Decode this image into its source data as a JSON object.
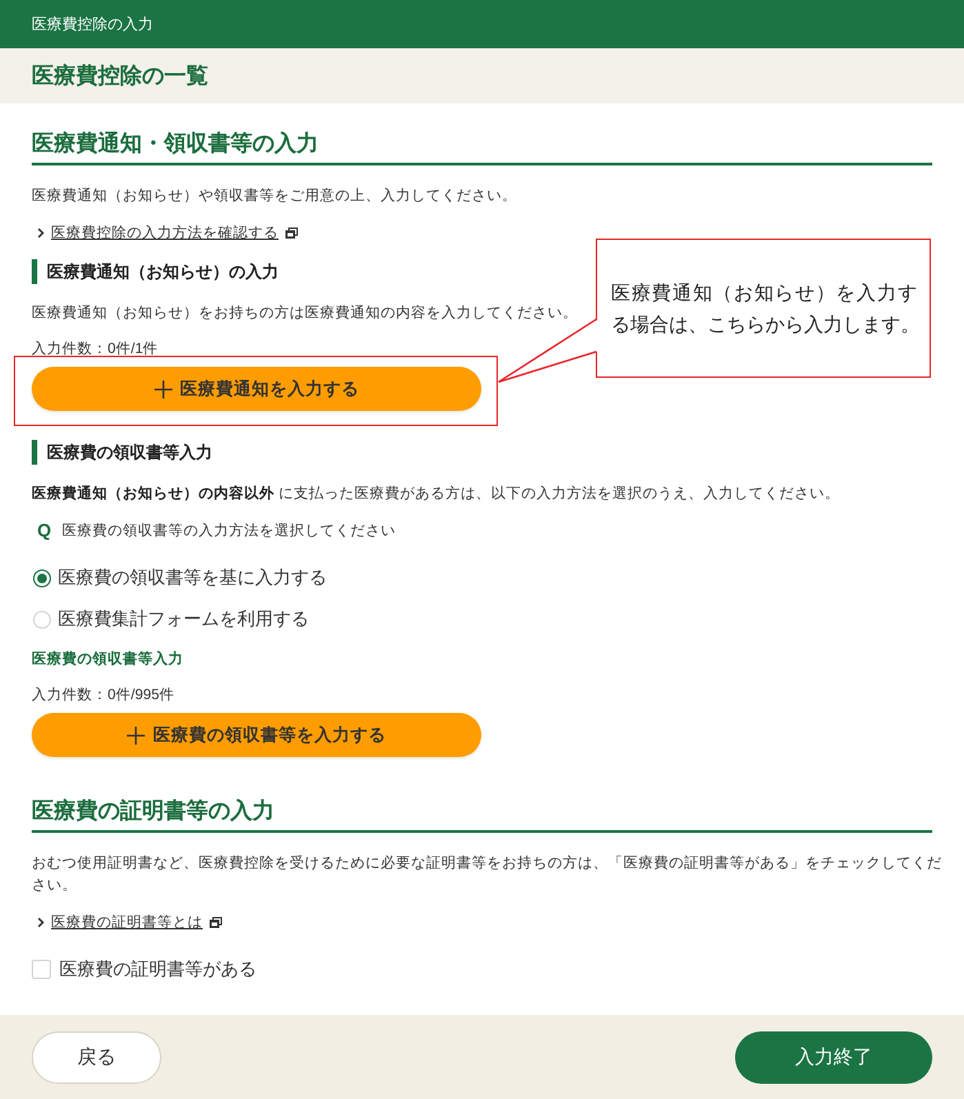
{
  "header": {
    "title": "医療費控除の入力"
  },
  "page_title": "医療費控除の一覧",
  "sections": [
    {
      "heading": "医療費通知・領収書等の入力",
      "blocks": [
        {
          "kind": "paragraph",
          "text": "医療費通知（お知らせ）や領収書等をご用意の上、入力してください。"
        },
        {
          "kind": "link",
          "label": "医療費控除の入力方法を確認する"
        },
        {
          "kind": "subheading",
          "text": "医療費通知（お知らせ）の入力"
        },
        {
          "kind": "paragraph",
          "text": "医療費通知（お知らせ）をお持ちの方は医療費通知の内容を入力してください。"
        },
        {
          "kind": "count",
          "text": "入力件数：0件/1件"
        },
        {
          "kind": "add_button",
          "label": "医療費通知を入力する",
          "callout": "医療費通知（お知らせ）を入力する場合は、こちらから入力します。"
        },
        {
          "kind": "subheading",
          "text": "医療費の領収書等入力"
        },
        {
          "kind": "paragraph",
          "text": "**医療費通知（お知らせ）の内容以外** に支払った医療費がある方は、以下の入力方法を選択のうえ、入力してください。"
        },
        {
          "kind": "question",
          "mark": "Q",
          "text": "医療費の領収書等の入力方法を選択してください"
        },
        {
          "kind": "radio_group",
          "options": [
            {
              "label": "医療費の領収書等を基に入力する",
              "selected": true
            },
            {
              "label": "医療費集計フォームを利用する",
              "selected": false
            }
          ]
        },
        {
          "kind": "field_label",
          "text": "医療費の領収書等入力"
        },
        {
          "kind": "count",
          "text": "入力件数：0件/995件"
        },
        {
          "kind": "add_button",
          "label": "医療費の領収書等を入力する"
        }
      ]
    },
    {
      "heading": "医療費の証明書等の入力",
      "blocks": [
        {
          "kind": "paragraph",
          "text": "おむつ使用証明書など、医療費控除を受けるために必要な証明書等をお持ちの方は、「医療費の証明書等がある」をチェックしてください。"
        },
        {
          "kind": "link",
          "label": "医療費の証明書等とは"
        },
        {
          "kind": "checkbox",
          "label": "医療費の証明書等がある",
          "checked": false
        }
      ]
    }
  ],
  "footer": {
    "buttons": [
      {
        "kind": "secondary",
        "label": "戻る"
      },
      {
        "kind": "primary",
        "label": "入力終了"
      }
    ]
  }
}
